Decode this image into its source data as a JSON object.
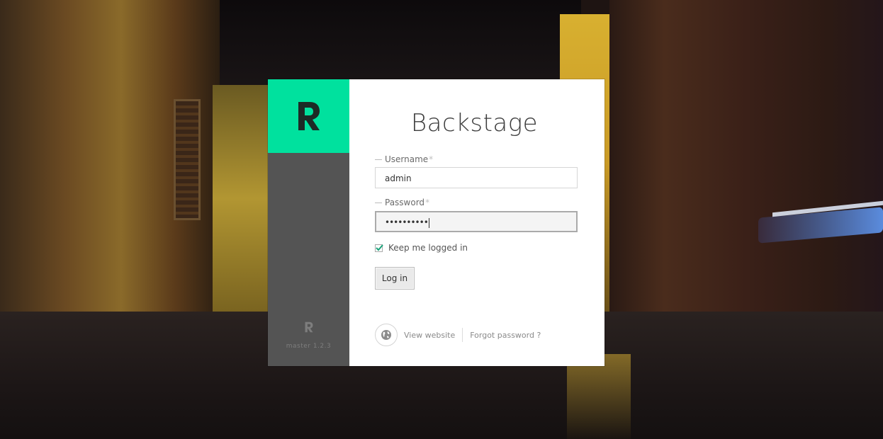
{
  "app": {
    "title": "Backstage",
    "version": "master 1.2.3",
    "brand_color": "#00e19e"
  },
  "form": {
    "username": {
      "label": "Username",
      "required_mark": "*",
      "value": "admin"
    },
    "password": {
      "label": "Password",
      "required_mark": "*",
      "masked_value": "••••••••••"
    },
    "remember": {
      "label": "Keep me logged in",
      "checked": true
    },
    "login_label": "Log in"
  },
  "footer": {
    "view_website": "View website",
    "forgot_password": "Forgot password ?"
  },
  "icons": {
    "logo": "R-logo-icon",
    "small_logo": "R-small-logo-icon",
    "globe": "globe-icon",
    "check": "check-icon"
  }
}
